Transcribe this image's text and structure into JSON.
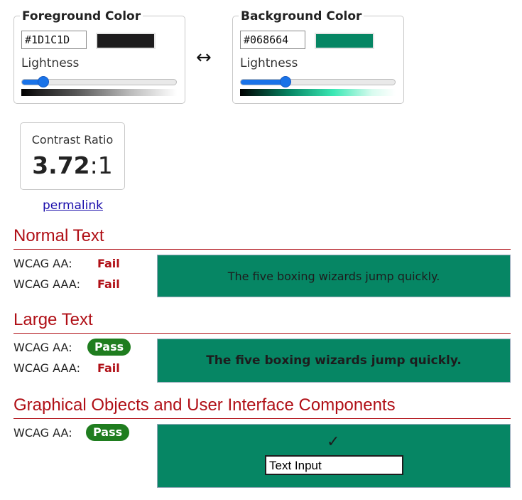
{
  "foreground": {
    "legend": "Foreground Color",
    "hex": "#1D1C1D",
    "swatch_color": "#1D1C1D",
    "lightness_label": "Lightness",
    "lightness_level": 0.14
  },
  "background": {
    "legend": "Background Color",
    "hex": "#068664",
    "swatch_color": "#068664",
    "lightness_label": "Lightness",
    "lightness_level": 0.29
  },
  "swap_icon": "↔",
  "contrast": {
    "label": "Contrast Ratio",
    "ratio_main": "3.72",
    "ratio_suffix": ":1",
    "permalink": "permalink"
  },
  "sections": {
    "normal": {
      "title": "Normal Text",
      "aa_label": "WCAG AA:",
      "aa_result": "Fail",
      "aaa_label": "WCAG AAA:",
      "aaa_result": "Fail",
      "sample": "The five boxing wizards jump quickly."
    },
    "large": {
      "title": "Large Text",
      "aa_label": "WCAG AA:",
      "aa_result": "Pass",
      "aaa_label": "WCAG AAA:",
      "aaa_result": "Fail",
      "sample": "The five boxing wizards jump quickly."
    },
    "graphical": {
      "title": "Graphical Objects and User Interface Components",
      "aa_label": "WCAG AA:",
      "aa_result": "Pass",
      "checkmark": "✓",
      "input_value": "Text Input"
    }
  },
  "colors": {
    "accent_red": "#b00f16",
    "pass_green": "#1f7d1f",
    "slider_blue": "#1a73e8"
  }
}
